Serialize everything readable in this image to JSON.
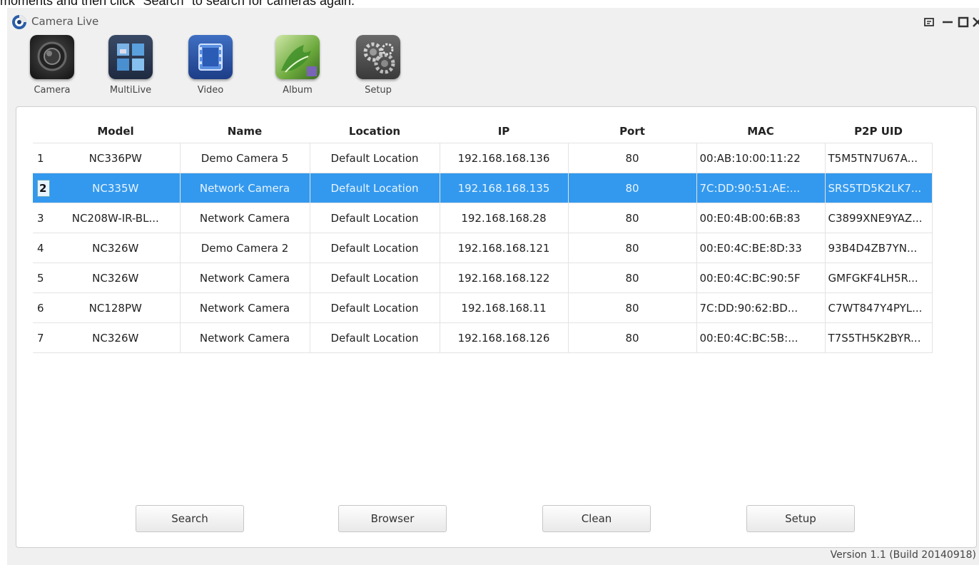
{
  "top_text": "moments and then click \"Search\" to search for cameras again.",
  "window": {
    "title": "Camera Live"
  },
  "toolbar": {
    "items": [
      {
        "label": "Camera",
        "icon": "camera-icon"
      },
      {
        "label": "MultiLive",
        "icon": "multilive-icon"
      },
      {
        "label": "Video",
        "icon": "video-icon"
      },
      {
        "label": "Album",
        "icon": "album-icon"
      },
      {
        "label": "Setup",
        "icon": "setup-icon"
      }
    ]
  },
  "table": {
    "columns": [
      "",
      "Model",
      "Name",
      "Location",
      "IP",
      "Port",
      "MAC",
      "P2P UID"
    ],
    "rows": [
      [
        "1",
        "NC336PW",
        "Demo Camera 5",
        "Default Location",
        "192.168.168.136",
        "80",
        "00:AB:10:00:11:22",
        "T5M5TN7U67A..."
      ],
      [
        "2",
        "NC335W",
        "Network Camera",
        "Default Location",
        "192.168.168.135",
        "80",
        "7C:DD:90:51:AE:...",
        "SRS5TD5K2LK7..."
      ],
      [
        "3",
        "NC208W-IR-BL...",
        "Network Camera",
        "Default Location",
        "192.168.168.28",
        "80",
        "00:E0:4B:00:6B:83",
        "C3899XNE9YAZ..."
      ],
      [
        "4",
        "NC326W",
        "Demo Camera 2",
        "Default Location",
        "192.168.168.121",
        "80",
        "00:E0:4C:BE:8D:33",
        "93B4D4ZB7YN..."
      ],
      [
        "5",
        "NC326W",
        "Network Camera",
        "Default Location",
        "192.168.168.122",
        "80",
        "00:E0:4C:BC:90:5F",
        "GMFGKF4LH5R..."
      ],
      [
        "6",
        "NC128PW",
        "Network Camera",
        "Default Location",
        "192.168.168.11",
        "80",
        "7C:DD:90:62:BD...",
        "C7WT847Y4PYL..."
      ],
      [
        "7",
        "NC326W",
        "Network Camera",
        "Default Location",
        "192.168.168.126",
        "80",
        "00:E0:4C:BC:5B:...",
        "T7S5TH5K2BYR..."
      ]
    ],
    "selected_row": 1
  },
  "buttons": {
    "search": "Search",
    "browser": "Browser",
    "clean": "Clean",
    "setup": "Setup"
  },
  "version": "Version 1.1 (Build 20140918)",
  "colors": {
    "selection": "#3399ee",
    "window_bg": "#f0f0f0"
  }
}
